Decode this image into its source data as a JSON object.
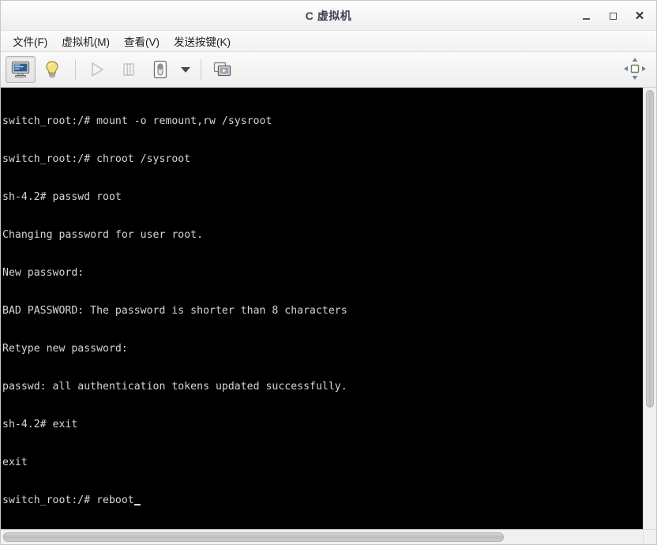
{
  "window": {
    "title": "C 虚拟机",
    "controls": {
      "minimize": "minimize",
      "maximize": "maximize",
      "close": "✕"
    }
  },
  "menubar": {
    "items": [
      {
        "label": "文件(F)",
        "name": "menu-file"
      },
      {
        "label": "虚拟机(M)",
        "name": "menu-virtual-machine"
      },
      {
        "label": "查看(V)",
        "name": "menu-view"
      },
      {
        "label": "发送按键(K)",
        "name": "menu-send-key"
      }
    ]
  },
  "toolbar": {
    "buttons": [
      {
        "name": "console-view-button",
        "icon": "monitor-icon",
        "state": "pressed",
        "enabled": true
      },
      {
        "name": "details-view-button",
        "icon": "lightbulb-icon",
        "state": "normal",
        "enabled": true
      },
      {
        "name": "run-button",
        "icon": "play-icon",
        "state": "normal",
        "enabled": false
      },
      {
        "name": "pause-button",
        "icon": "pause-icon",
        "state": "normal",
        "enabled": false
      },
      {
        "name": "shutdown-button",
        "icon": "power-icon",
        "state": "normal",
        "enabled": true
      },
      {
        "name": "shutdown-dropdown",
        "icon": "chevron-down-icon",
        "state": "normal",
        "enabled": true
      },
      {
        "name": "snapshot-button",
        "icon": "snapshots-icon",
        "state": "normal",
        "enabled": true
      }
    ],
    "fullscreen": {
      "name": "fullscreen-button",
      "icon": "fullscreen-icon"
    }
  },
  "terminal": {
    "lines": [
      "switch_root:/# mount -o remount,rw /sysroot",
      "switch_root:/# chroot /sysroot",
      "sh-4.2# passwd root",
      "Changing password for user root.",
      "New password:",
      "BAD PASSWORD: The password is shorter than 8 characters",
      "Retype new password:",
      "passwd: all authentication tokens updated successfully.",
      "sh-4.2# exit",
      "exit"
    ],
    "prompt_line": "switch_root:/# reboot",
    "cursor": "block"
  },
  "scrollbars": {
    "vertical": {
      "name": "vertical-scrollbar",
      "thumb_percent": 72
    },
    "horizontal": {
      "name": "horizontal-scrollbar",
      "thumb_percent": 78
    }
  },
  "colors": {
    "terminal_bg": "#000000",
    "terminal_fg": "#d6d6d6",
    "chrome_bg": "#f2f2f2",
    "title_fg": "#3c4350"
  }
}
